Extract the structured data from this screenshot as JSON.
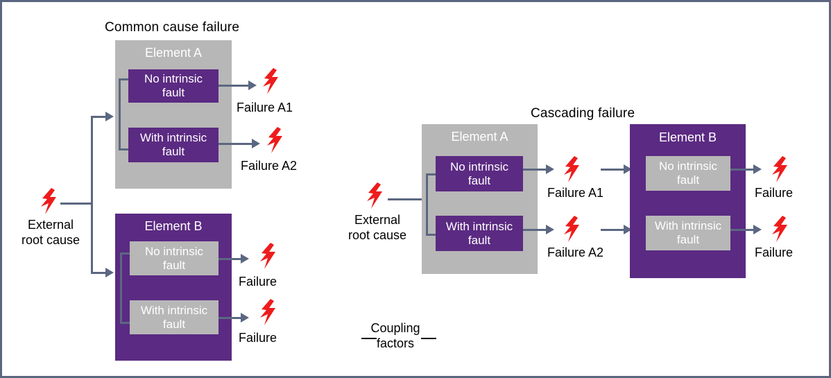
{
  "figure": {
    "outer_border_color": "#5b6781",
    "background": "#ffffff",
    "palette": {
      "purple": "#5b2a82",
      "gray": "#b7b7b7",
      "connector": "#5b6781",
      "bolt_red": "#ee1c1c",
      "text_dark": "#000000",
      "text_light": "#ffffff"
    }
  },
  "sections": {
    "common_cause": {
      "title": "Common cause failure",
      "root_cause": {
        "label_line1": "External",
        "label_line2": "root cause",
        "icon": "lightning-bolt-icon"
      },
      "element_a": {
        "title": "Element A",
        "container_color": "#b7b7b7",
        "states": [
          {
            "line1": "No  intrinsic",
            "line2": "fault",
            "color": "#5b2a82"
          },
          {
            "line1": "With  intrinsic",
            "line2": "fault",
            "color": "#5b2a82"
          }
        ],
        "outputs": [
          {
            "label": "Failure  A1",
            "icon": "lightning-bolt-icon"
          },
          {
            "label": "Failure  A2",
            "icon": "lightning-bolt-icon"
          }
        ]
      },
      "element_b": {
        "title": "Element B",
        "container_color": "#5b2a82",
        "states": [
          {
            "line1": "No intrinsic",
            "line2": "fault",
            "color": "#b7b7b7"
          },
          {
            "line1": "With intrinsic",
            "line2": "fault",
            "color": "#b7b7b7"
          }
        ],
        "outputs": [
          {
            "label": "Failure",
            "icon": "lightning-bolt-icon"
          },
          {
            "label": "Failure",
            "icon": "lightning-bolt-icon"
          }
        ]
      }
    },
    "cascading": {
      "title": "Cascading  failure",
      "root_cause": {
        "label_line1": "External",
        "label_line2": "root cause",
        "icon": "lightning-bolt-icon"
      },
      "element_a": {
        "title": "Element A",
        "container_color": "#b7b7b7",
        "states": [
          {
            "line1": "No  intrinsic",
            "line2": "fault",
            "color": "#5b2a82"
          },
          {
            "line1": "With intrinsic",
            "line2": "fault",
            "color": "#5b2a82"
          }
        ],
        "outputs": [
          {
            "label": "Failure  A1",
            "icon": "lightning-bolt-icon"
          },
          {
            "label": "Failure  A2",
            "icon": "lightning-bolt-icon"
          }
        ]
      },
      "element_b": {
        "title": "Element B",
        "container_color": "#5b2a82",
        "states": [
          {
            "line1": "No intrinsic",
            "line2": "fault",
            "color": "#b7b7b7"
          },
          {
            "line1": "With intrinsic",
            "line2": "fault",
            "color": "#b7b7b7"
          }
        ],
        "outputs": [
          {
            "label": "Failure",
            "icon": "lightning-bolt-icon"
          },
          {
            "label": "Failure",
            "icon": "lightning-bolt-icon"
          }
        ]
      }
    }
  },
  "legend": {
    "coupling_line1": "Coupling",
    "coupling_line2": "factors"
  }
}
